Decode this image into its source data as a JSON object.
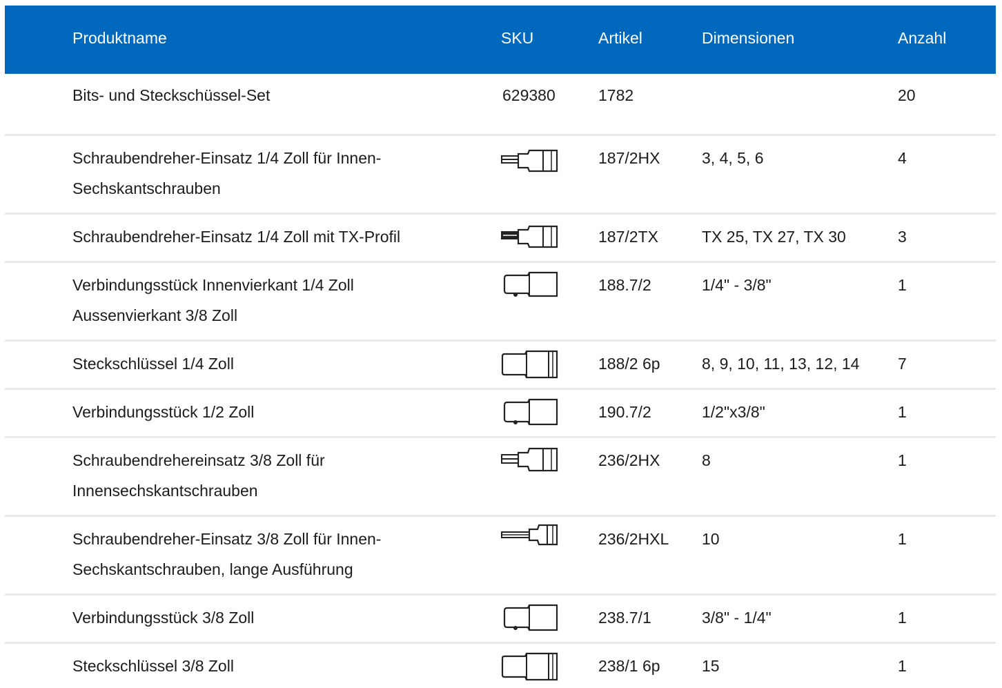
{
  "header": {
    "name": "Produktname",
    "sku": "SKU",
    "article": "Artikel",
    "dimensions": "Dimensionen",
    "quantity": "Anzahl"
  },
  "rows": [
    {
      "name": "Bits- und Steckschüssel-Set",
      "sku": "629380",
      "icon": "",
      "article": "1782",
      "dimensions": "",
      "quantity": "20"
    },
    {
      "name": "Schraubendreher-Einsatz 1/4 Zoll für Innen-Sechskantschrauben",
      "sku": "",
      "icon": "hex-bit-socket-icon",
      "article": "187/2HX",
      "dimensions": "3, 4, 5, 6",
      "quantity": "4"
    },
    {
      "name": "Schraubendreher-Einsatz 1/4 Zoll mit TX-Profil",
      "sku": "",
      "icon": "torx-bit-socket-icon",
      "article": "187/2TX",
      "dimensions": "TX 25, TX 27, TX 30",
      "quantity": "3"
    },
    {
      "name": "Verbindungsstück Innenvierkant 1/4 Zoll Aussenvierkant 3/8 Zoll",
      "sku": "",
      "icon": "adapter-icon",
      "article": "188.7/2",
      "dimensions": "1/4\" - 3/8\"",
      "quantity": "1"
    },
    {
      "name": "Steckschlüssel 1/4 Zoll",
      "sku": "",
      "icon": "socket-icon",
      "article": "188/2 6p",
      "dimensions": "8, 9, 10, 11, 13, 12, 14",
      "quantity": "7"
    },
    {
      "name": "Verbindungsstück 1/2 Zoll",
      "sku": "",
      "icon": "adapter-icon",
      "article": "190.7/2",
      "dimensions": "1/2\"x3/8\"",
      "quantity": "1"
    },
    {
      "name": "Schraubendrehereinsatz 3/8 Zoll für Innensechskantschrauben",
      "sku": "",
      "icon": "hex-bit-socket-icon",
      "article": "236/2HX",
      "dimensions": "8",
      "quantity": "1"
    },
    {
      "name": "Schraubendreher-Einsatz 3/8 Zoll für Innen-Sechskantschrauben, lange Ausführung",
      "sku": "",
      "icon": "long-hex-bit-socket-icon",
      "article": "236/2HXL",
      "dimensions": "10",
      "quantity": "1"
    },
    {
      "name": "Verbindungsstück 3/8 Zoll",
      "sku": "",
      "icon": "adapter-icon",
      "article": "238.7/1",
      "dimensions": "3/8\" - 1/4\"",
      "quantity": "1"
    },
    {
      "name": "Steckschlüssel 3/8 Zoll",
      "sku": "",
      "icon": "socket-icon",
      "article": "238/1 6p",
      "dimensions": "15",
      "quantity": "1"
    }
  ]
}
